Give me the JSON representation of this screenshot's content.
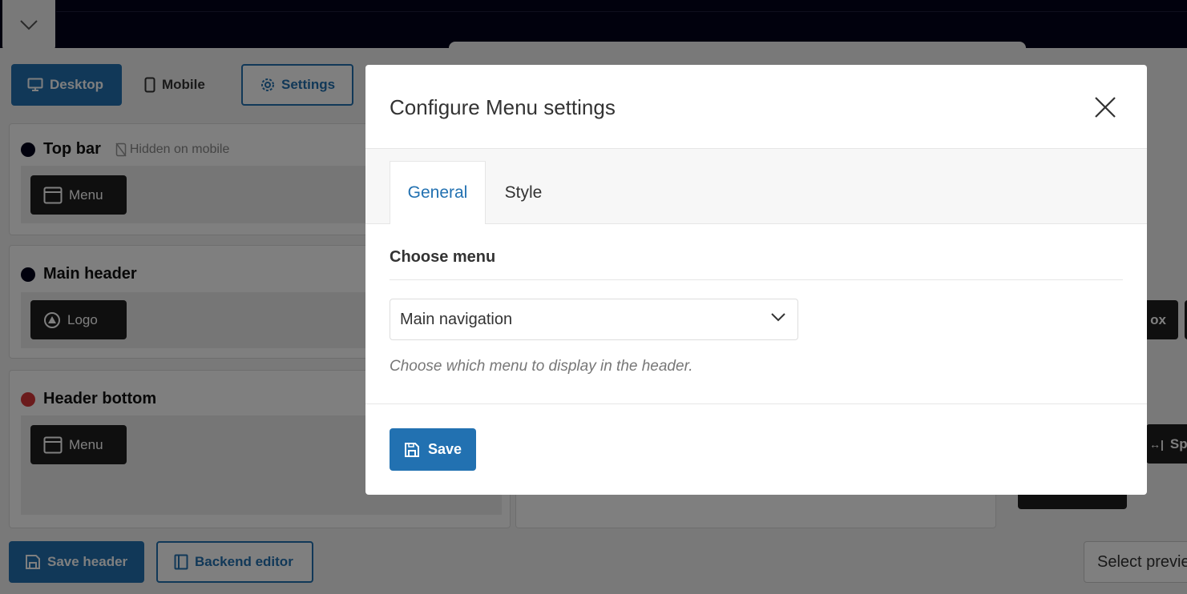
{
  "toolbar": {
    "desktop_label": "Desktop",
    "mobile_label": "Mobile",
    "settings_label": "Settings"
  },
  "sections": [
    {
      "title": "Top bar",
      "dot_color": "#03031b",
      "note": "Hidden on mobile",
      "element": "Menu"
    },
    {
      "title": "Main header",
      "dot_color": "#03031b",
      "element": "Logo"
    },
    {
      "title": "Header bottom",
      "dot_color": "#d63638",
      "element": "Menu"
    }
  ],
  "right_fragments": {
    "a": "ox",
    "b": "Sp"
  },
  "footer": {
    "save_header_label": "Save header",
    "backend_editor_label": "Backend editor",
    "select_preview_label": "Select previe"
  },
  "modal": {
    "title": "Configure Menu settings",
    "tabs": [
      {
        "label": "General",
        "active": true
      },
      {
        "label": "Style",
        "active": false
      }
    ],
    "choose_menu_label": "Choose menu",
    "selected_menu": "Main navigation",
    "help_text": "Choose which menu to display in the header.",
    "save_label": "Save"
  },
  "colors": {
    "accent": "#2271b1",
    "header_dark": "#03031b",
    "dark_button": "#1e1e1e"
  }
}
